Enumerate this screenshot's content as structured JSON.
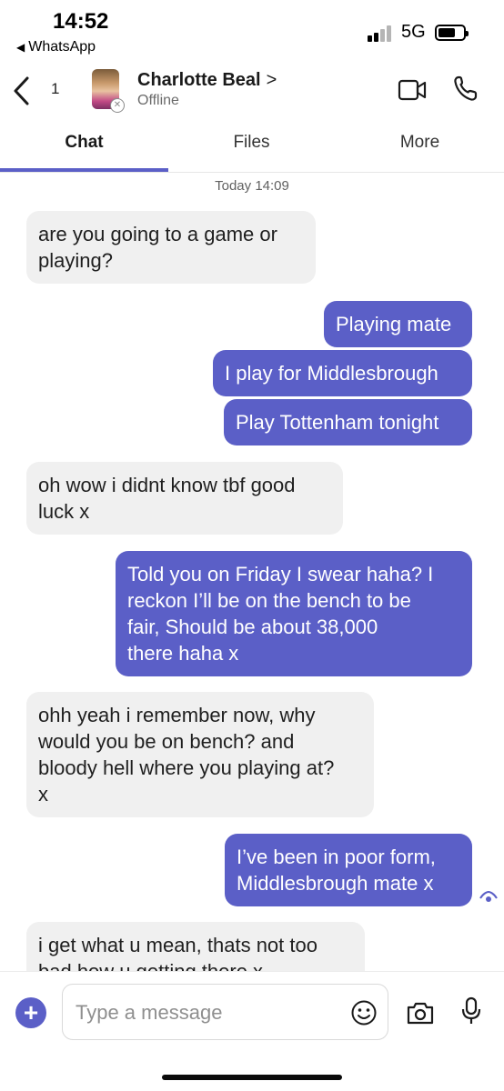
{
  "status_bar": {
    "time": "14:52",
    "back_app": "WhatsApp",
    "network": "5G",
    "back_icon": "triangle-left-icon",
    "signal_icon": "signal-bars-icon",
    "battery_icon": "battery-icon"
  },
  "header": {
    "back_count": "1",
    "contact_name": "Charlotte Beal",
    "contact_chevron": ">",
    "contact_status": "Offline",
    "icons": {
      "back": "chevron-left-icon",
      "video": "video-camera-icon",
      "call": "phone-icon",
      "presence": "offline-presence-icon"
    }
  },
  "tabs": [
    {
      "label": "Chat",
      "active": true
    },
    {
      "label": "Files",
      "active": false
    },
    {
      "label": "More",
      "active": false
    }
  ],
  "chat": {
    "timestamp": "Today 14:09",
    "messages": [
      {
        "direction": "in",
        "lines": [
          "are you going to a game or",
          "playing?"
        ]
      },
      {
        "direction": "out",
        "lines": [
          "Playing mate"
        ]
      },
      {
        "direction": "out",
        "lines": [
          "I play for Middlesbrough"
        ]
      },
      {
        "direction": "out",
        "lines": [
          "Play Tottenham tonight"
        ]
      },
      {
        "direction": "in",
        "lines": [
          "oh wow i didnt know tbf good",
          "luck x"
        ]
      },
      {
        "direction": "out",
        "lines": [
          "Told you on Friday I swear haha? I",
          "reckon I’ll be on the bench to be",
          "fair, Should be about 38,000",
          "there haha x"
        ]
      },
      {
        "direction": "in",
        "lines": [
          "ohh yeah i remember now, why",
          "would you be on bench? and",
          "bloody hell where you playing at?",
          "x"
        ]
      },
      {
        "direction": "out",
        "lines": [
          "I’ve been in poor form,",
          "Middlesbrough mate x"
        ]
      },
      {
        "direction": "in",
        "lines": [
          "i get what u mean, thats not too",
          "bad how u getting there x"
        ]
      }
    ],
    "read_receipt_icon": "seen-eye-icon"
  },
  "composer": {
    "placeholder": "Type a message",
    "icons": {
      "add": "plus-icon",
      "emoji": "emoji-icon",
      "camera": "camera-icon",
      "mic": "microphone-icon"
    }
  },
  "colors": {
    "accent": "#5b5fc7",
    "incoming_bubble": "#f0f0f0",
    "outgoing_text": "#ffffff"
  }
}
